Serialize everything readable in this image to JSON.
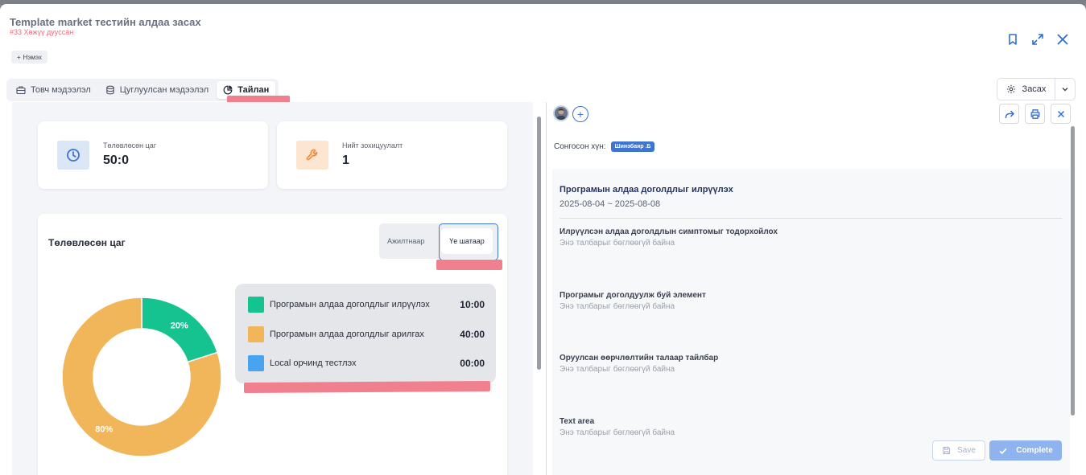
{
  "header": {
    "title": "Template market тестийн алдаа засах",
    "subtitle": "#33 Хөжүү дууссан",
    "add_label": "Нэмэх",
    "icons": [
      "bookmark-icon",
      "expand-icon",
      "close-icon"
    ]
  },
  "tabs": [
    {
      "label": "Товч мэдээлэл",
      "icon": "briefcase-icon",
      "active": false
    },
    {
      "label": "Цуглуулсан мэдээлэл",
      "icon": "database-icon",
      "active": false
    },
    {
      "label": "Тайлан",
      "icon": "pie-chart-icon",
      "active": true
    }
  ],
  "edit_button": {
    "label": "Засах"
  },
  "stats": [
    {
      "label": "Төлөвлөсөн цаг",
      "value": "50:0",
      "icon": "clock-icon",
      "color": "#dbe7f7"
    },
    {
      "label": "Нийт зохицуулалт",
      "value": "1",
      "icon": "wrench-icon",
      "color": "#fde6d1"
    }
  ],
  "chart_card": {
    "title": "Төлөвлөсөн цаг",
    "toggle": {
      "option1": "Ажилтнаар",
      "option2": "Үе шатаар",
      "selected": "Үе шатаар"
    }
  },
  "chart_data": {
    "type": "pie",
    "donut": true,
    "categories": [
      "Програмын алдаа доголдлыг илрүүлэх",
      "Програмын алдаа доголдлыг арилгах",
      "Local орчинд тестлэх"
    ],
    "values": [
      20,
      80,
      0
    ],
    "data_labels": [
      "20%",
      "80%",
      ""
    ],
    "durations": [
      "10:00",
      "40:00",
      "00:00"
    ],
    "colors": [
      "#15c391",
      "#f2b65a",
      "#4aa3ee"
    ]
  },
  "right": {
    "chosen_label": "Сонгосон хүн:",
    "chosen_person": "Шинэбаяр .Б",
    "phase_title": "Програмын алдаа доголдлыг илрүүлэх",
    "phase_dates": "2025-08-04 ~ 2025-08-08",
    "empty_text": "Энэ талбарыг бөглөөгүй байна",
    "fields": [
      "Илрүүлсэн алдаа доголдлын симптомыг тодорхойлох",
      "Програмыг доголдуулж буй элемент",
      "Оруулсан өөрчлөлтийн талаар тайлбар",
      "Text area"
    ],
    "save_label": "Save",
    "complete_label": "Complete"
  }
}
